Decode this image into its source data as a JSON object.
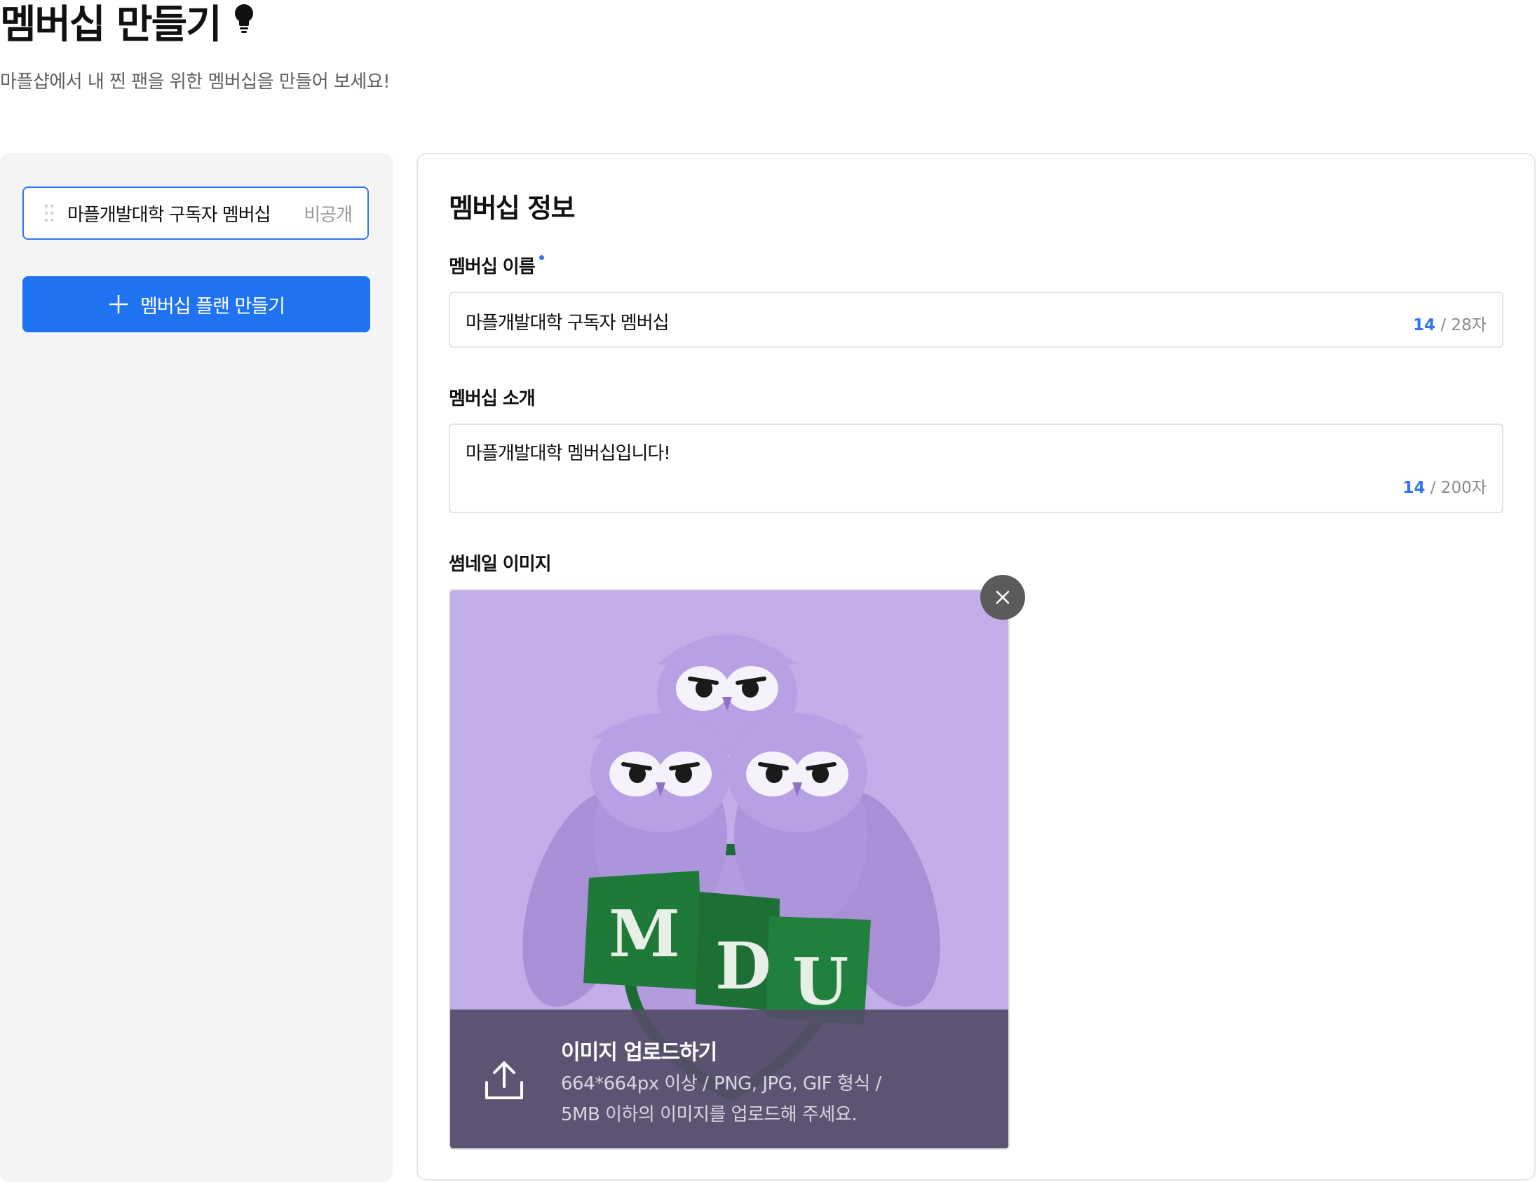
{
  "page": {
    "title": "멤버십 만들기",
    "subtitle": "마플샵에서 내 찐 팬을 위한 멤버십을 만들어 보세요!",
    "title_icon": "lightbulb-icon"
  },
  "sidebar": {
    "membership_items": [
      {
        "name": "마플개발대학 구독자 멤버십",
        "visibility": "비공개"
      }
    ],
    "create_plan_label": "멤버십 플랜 만들기"
  },
  "form": {
    "section_title": "멤버십 정보",
    "name": {
      "label": "멤버십 이름",
      "value": "마플개발대학 구독자 멤버십",
      "count": "14",
      "max": " / 28자"
    },
    "intro": {
      "label": "멤버십 소개",
      "value": "마플개발대학 멤버십입니다!",
      "count": "14",
      "max": " / 200자"
    },
    "thumbnail": {
      "label": "썸네일 이미지",
      "upload_title": "이미지 업로드하기",
      "upload_desc_line1": "664*664px 이상 / PNG, JPG, GIF 형식 /",
      "upload_desc_line2": "5MB 이하의 이미지를 업로드해 주세요.",
      "image_letters": [
        "M",
        "D",
        "U"
      ]
    }
  },
  "colors": {
    "accent": "#1f73f1",
    "thumbnail_bg": "#c4aee9",
    "banner_green": "#1f7a3a"
  }
}
